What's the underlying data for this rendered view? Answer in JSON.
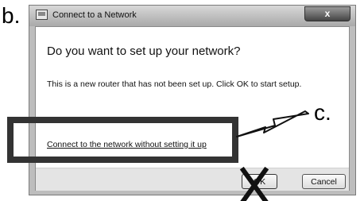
{
  "annotations": {
    "label_b": "b.",
    "label_c": "c."
  },
  "window": {
    "title": "Connect to a Network",
    "close_glyph": "x",
    "title_icon": "network-icon"
  },
  "dialog": {
    "heading": "Do you want to set up your network?",
    "description": "This is a new router that has not been set up. Click OK to start setup.",
    "link": "Connect to the network without setting it up",
    "ok_label": "OK",
    "cancel_label": "Cancel"
  }
}
